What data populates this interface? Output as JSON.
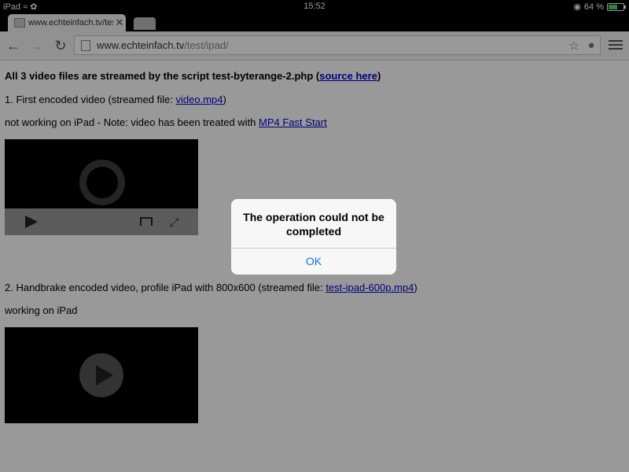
{
  "statusbar": {
    "device": "iPad",
    "time": "15:52",
    "battery_text": "64 %",
    "battery_level": 0.64
  },
  "tabs": [
    {
      "title": "www.echteinfach.tv/test/i..."
    }
  ],
  "toolbar": {
    "url_host": "www.echteinfach.tv",
    "url_path": "/test/ipad/"
  },
  "page": {
    "heading_prefix": "All 3 video files are streamed by the script test-byterange-2.php (",
    "heading_link": "source here",
    "heading_suffix": ")",
    "item1_prefix": "1. First encoded video (streamed file: ",
    "item1_link": "video.mp4",
    "item1_suffix": ")",
    "note1_prefix": "not working on iPad - Note: video has been treated with ",
    "note1_link": "MP4 Fast Start",
    "item2_prefix": "2. Handbrake encoded video, profile iPad with 800x600 (streamed file: ",
    "item2_link": "test-ipad-600p.mp4",
    "item2_suffix": ")",
    "note2": "working on iPad"
  },
  "alert": {
    "message": "The operation could not be completed",
    "ok_label": "OK"
  }
}
